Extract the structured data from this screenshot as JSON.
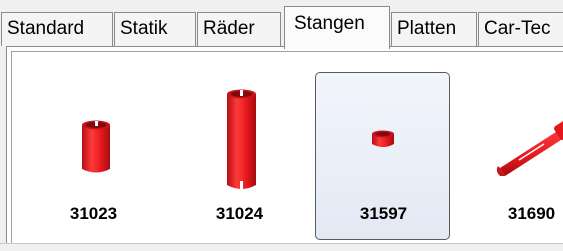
{
  "tabs": [
    {
      "label": "Standard"
    },
    {
      "label": "Statik"
    },
    {
      "label": "Räder"
    },
    {
      "label": "Stangen"
    },
    {
      "label": "Platten"
    },
    {
      "label": "Car-Tec"
    }
  ],
  "active_tab": "Stangen",
  "parts": [
    {
      "id": "31023",
      "icon": "short-red-tube-icon",
      "selected": false
    },
    {
      "id": "31024",
      "icon": "long-red-tube-icon",
      "selected": false
    },
    {
      "id": "31597",
      "icon": "small-red-ring-icon",
      "selected": true
    },
    {
      "id": "31690",
      "icon": "red-axle-pin-icon",
      "selected": false
    }
  ],
  "colors": {
    "part_red": "#e2171d",
    "selection_bg": "#e8edf6",
    "selection_border": "#5a5a5a"
  }
}
